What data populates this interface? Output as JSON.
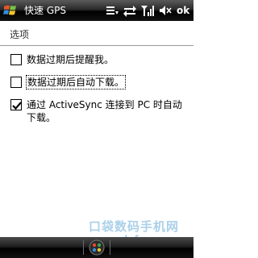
{
  "titlebar": {
    "app_title": "快速 GPS",
    "ok_label": "ok",
    "icons": [
      "windows-start-icon",
      "menu-icon",
      "connectivity-icon",
      "signal-icon",
      "volume-icon"
    ]
  },
  "content": {
    "section_header": "选项",
    "options": [
      {
        "label": "数据过期后提醒我。",
        "checked": false
      },
      {
        "label": "数据过期后自动下载。",
        "checked": false
      },
      {
        "label": "通过 ActiveSync 连接到 PC 时自动下载。",
        "checked": true
      }
    ]
  },
  "watermark": {
    "text": "口袋数码手机网",
    "url": "www.pdafans.com"
  },
  "menubar": {
    "icons": [
      "keyboard-icon"
    ]
  },
  "colors": {
    "bar_bg": "#000000",
    "watermark": "#9cc8e6",
    "text": "#000000"
  }
}
